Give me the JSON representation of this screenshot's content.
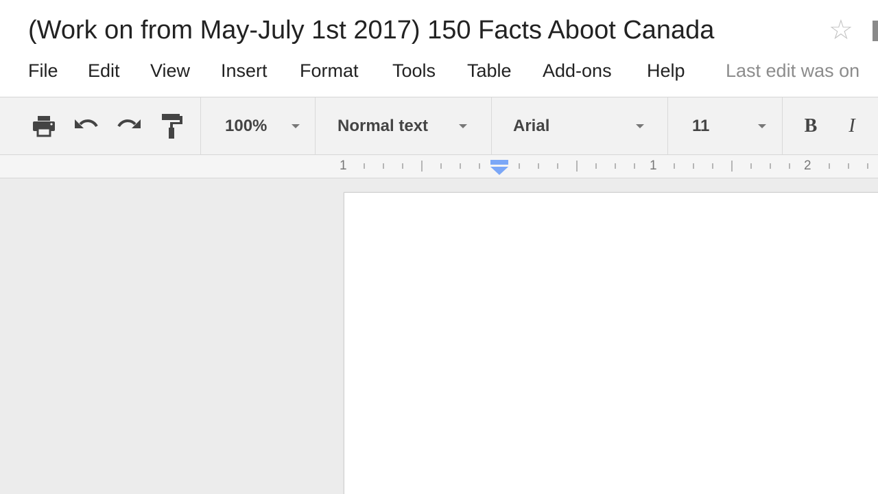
{
  "document": {
    "title": "(Work on from May-July 1st 2017) 150 Facts Aboot Canada",
    "star_icon": "star-outline-icon"
  },
  "menu": {
    "file": "File",
    "edit": "Edit",
    "view": "View",
    "insert": "Insert",
    "format": "Format",
    "tools": "Tools",
    "table": "Table",
    "addons": "Add-ons",
    "help": "Help",
    "last_edit": "Last edit was on"
  },
  "toolbar": {
    "icons": [
      "print-icon",
      "undo-icon",
      "redo-icon",
      "paint-format-icon"
    ],
    "zoom": "100%",
    "style": "Normal text",
    "font": "Arial",
    "font_size": "11",
    "bold": "B",
    "italic": "I"
  },
  "ruler": {
    "labels": [
      "1",
      "1",
      "2"
    ]
  },
  "colors": {
    "indent_marker": "#7ba7f7",
    "canvas_bg": "#ececec",
    "toolbar_bg": "#f2f2f2"
  }
}
